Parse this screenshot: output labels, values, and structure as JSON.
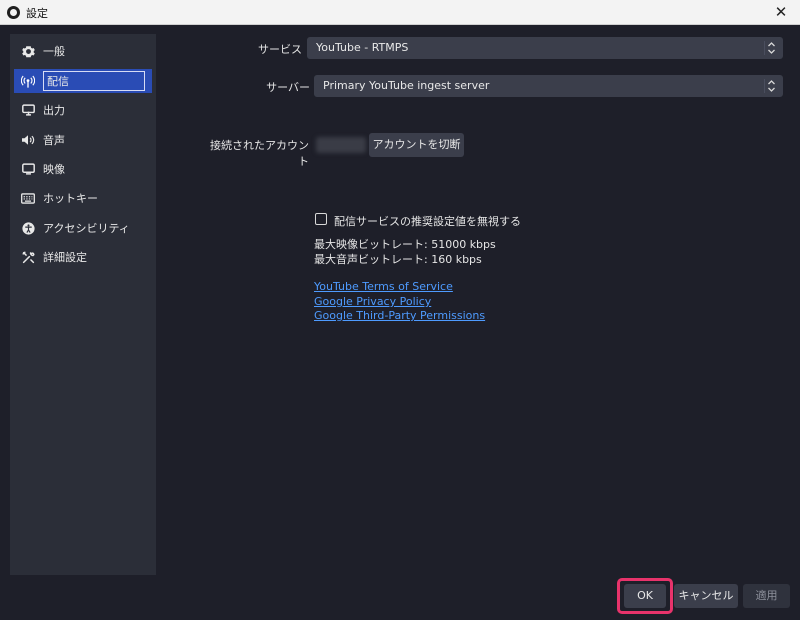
{
  "window": {
    "title": "設定",
    "close_glyph": "✕"
  },
  "sidebar": {
    "items": [
      {
        "label": "一般",
        "icon": "gear-icon"
      },
      {
        "label": "配信",
        "icon": "broadcast-icon",
        "active": true
      },
      {
        "label": "出力",
        "icon": "output-icon"
      },
      {
        "label": "音声",
        "icon": "speaker-icon"
      },
      {
        "label": "映像",
        "icon": "monitor-icon"
      },
      {
        "label": "ホットキー",
        "icon": "keyboard-icon"
      },
      {
        "label": "アクセシビリティ",
        "icon": "accessibility-icon"
      },
      {
        "label": "詳細設定",
        "icon": "tools-icon"
      }
    ]
  },
  "stream": {
    "service_label": "サービス",
    "service_value": "YouTube - RTMPS",
    "server_label": "サーバー",
    "server_value": "Primary YouTube ingest server",
    "account_label": "接続されたアカウント",
    "disconnect_button": "アカウントを切断",
    "ignore_recommended_label": "配信サービスの推奨設定値を無視する",
    "ignore_recommended_checked": false,
    "max_video_bitrate": "最大映像ビットレート: 51000 kbps",
    "max_audio_bitrate": "最大音声ビットレート: 160 kbps",
    "links": [
      "YouTube Terms of Service",
      "Google Privacy Policy",
      "Google Third-Party Permissions"
    ]
  },
  "footer": {
    "ok_label": "OK",
    "cancel_label": "キャンセル",
    "apply_label": "適用"
  },
  "colors": {
    "background": "#1e1f29",
    "sidebar": "#2b2e38",
    "active_item": "#2a4cb5",
    "link": "#4e9bff",
    "highlight": "#e8336b"
  }
}
